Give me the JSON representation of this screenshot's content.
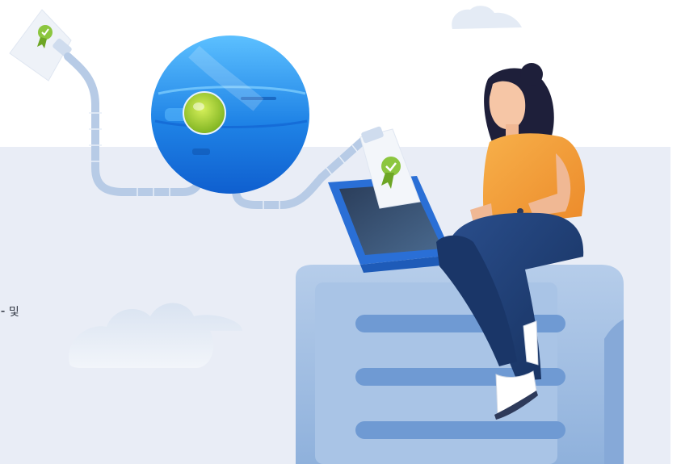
{
  "background": {
    "page_color": "#ffffff",
    "panel_color": "#e9edf6"
  },
  "text_fragment": "⁃ 및",
  "illustration": {
    "elements": [
      "certificate-icon",
      "ribbon-badge-icon",
      "globe-icon",
      "pipe",
      "laptop-icon",
      "server-icon",
      "person",
      "cloud-icon"
    ],
    "colors": {
      "globe": "#2f8ee8",
      "globe_lens": "#9ccc2a",
      "badge": "#8cc63f",
      "shirt": "#f29b38",
      "jeans": "#1f3f77",
      "server": "#9bbbe0",
      "laptop": "#2a6fd6"
    }
  }
}
